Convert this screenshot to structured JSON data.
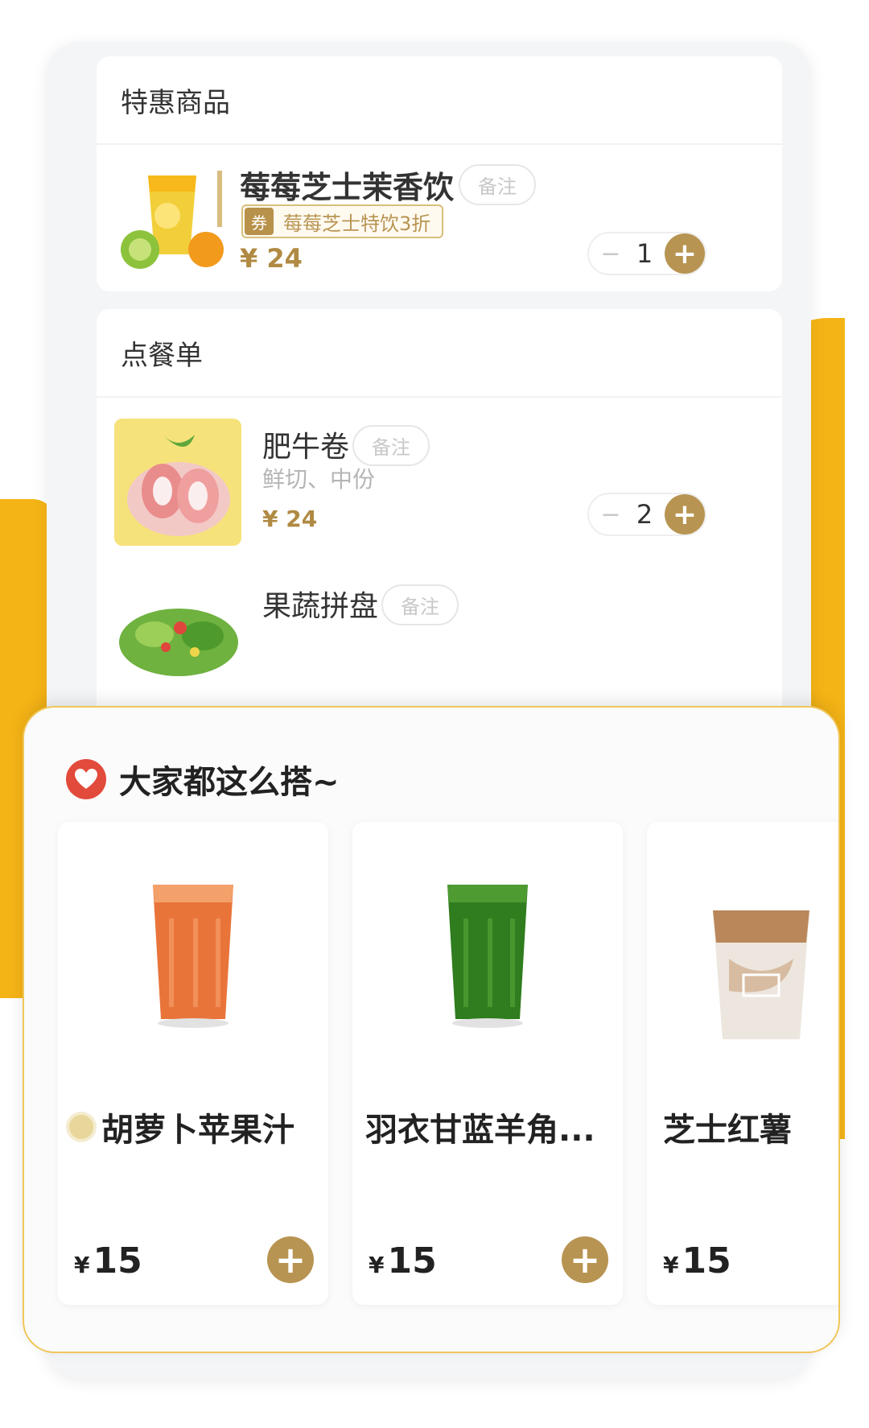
{
  "special": {
    "section_title": "特惠商品",
    "item": {
      "name": "莓莓芝士茉香饮",
      "note_label": "备注",
      "coupon_tag": "券",
      "coupon_text": "莓莓芝士特饮3折",
      "price": "¥ 24",
      "quantity": "1"
    }
  },
  "order": {
    "section_title": "点餐单",
    "items": [
      {
        "name": "肥牛卷",
        "note_label": "备注",
        "spec": "鲜切、中份",
        "price": "¥ 24",
        "quantity": "2"
      },
      {
        "name": "果蔬拼盘",
        "note_label": "备注"
      }
    ]
  },
  "recommend": {
    "title": "大家都这么搭~",
    "products": [
      {
        "name": "胡萝卜苹果汁",
        "currency": "¥",
        "price": "15"
      },
      {
        "name": "羽衣甘蓝羊角...",
        "currency": "¥",
        "price": "15"
      },
      {
        "name": "芝士红薯",
        "currency": "¥",
        "price": "15"
      }
    ]
  },
  "colors": {
    "accent_gold": "#b89452",
    "brand_yellow": "#f5b416",
    "heart_red": "#e24a3b"
  }
}
